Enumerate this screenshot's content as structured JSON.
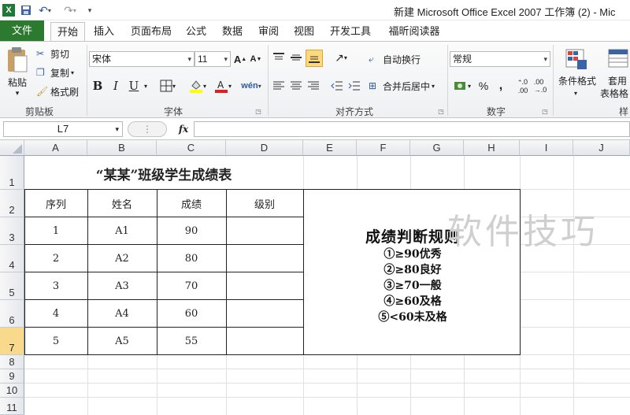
{
  "window": {
    "title": "新建 Microsoft Office Excel 2007 工作簿 (2) - Mic"
  },
  "tabs": [
    "文件",
    "开始",
    "插入",
    "页面布局",
    "公式",
    "数据",
    "审阅",
    "视图",
    "开发工具",
    "福昕阅读器"
  ],
  "ribbon": {
    "clipboard": {
      "paste": "粘贴",
      "cut": "剪切",
      "copy": "复制",
      "format_painter": "格式刷",
      "label": "剪贴板"
    },
    "font": {
      "name": "宋体",
      "size": "11",
      "label": "字体",
      "bold": "B",
      "italic": "I",
      "underline": "U"
    },
    "alignment": {
      "wrap": "自动换行",
      "merge": "合并后居中",
      "label": "对齐方式"
    },
    "number": {
      "format": "常规",
      "label": "数字",
      "percent": "%",
      "comma": ","
    },
    "styles": {
      "conditional": "条件格式",
      "table_format_1": "套用",
      "table_format_2": "表格格",
      "label": "样"
    }
  },
  "formula_bar": {
    "name_box": "L7",
    "fx": "fx",
    "value": ""
  },
  "columns": [
    "A",
    "B",
    "C",
    "D",
    "E",
    "F",
    "G",
    "H",
    "I",
    "J"
  ],
  "rows": [
    "1",
    "2",
    "3",
    "4",
    "5",
    "6",
    "7",
    "8",
    "9",
    "10",
    "11"
  ],
  "sheet": {
    "title": "“某某”班级学生成绩表",
    "headers": [
      "序列",
      "姓名",
      "成绩",
      "级别"
    ],
    "records": [
      {
        "seq": "1",
        "name": "A1",
        "score": "90",
        "level": ""
      },
      {
        "seq": "2",
        "name": "A2",
        "score": "80",
        "level": ""
      },
      {
        "seq": "3",
        "name": "A3",
        "score": "70",
        "level": ""
      },
      {
        "seq": "4",
        "name": "A4",
        "score": "60",
        "level": ""
      },
      {
        "seq": "5",
        "name": "A5",
        "score": "55",
        "level": ""
      }
    ],
    "rules_title": "成绩判断规则",
    "rules": [
      "①≥90优秀",
      "②≥80良好",
      "③≥70一般",
      "④≥60及格",
      "⑤<60未及格"
    ]
  },
  "selected_row": "7",
  "watermark": "软件技巧",
  "colors": {
    "file_tab": "#2b7a2f",
    "selected_header": "#f9d98c"
  }
}
